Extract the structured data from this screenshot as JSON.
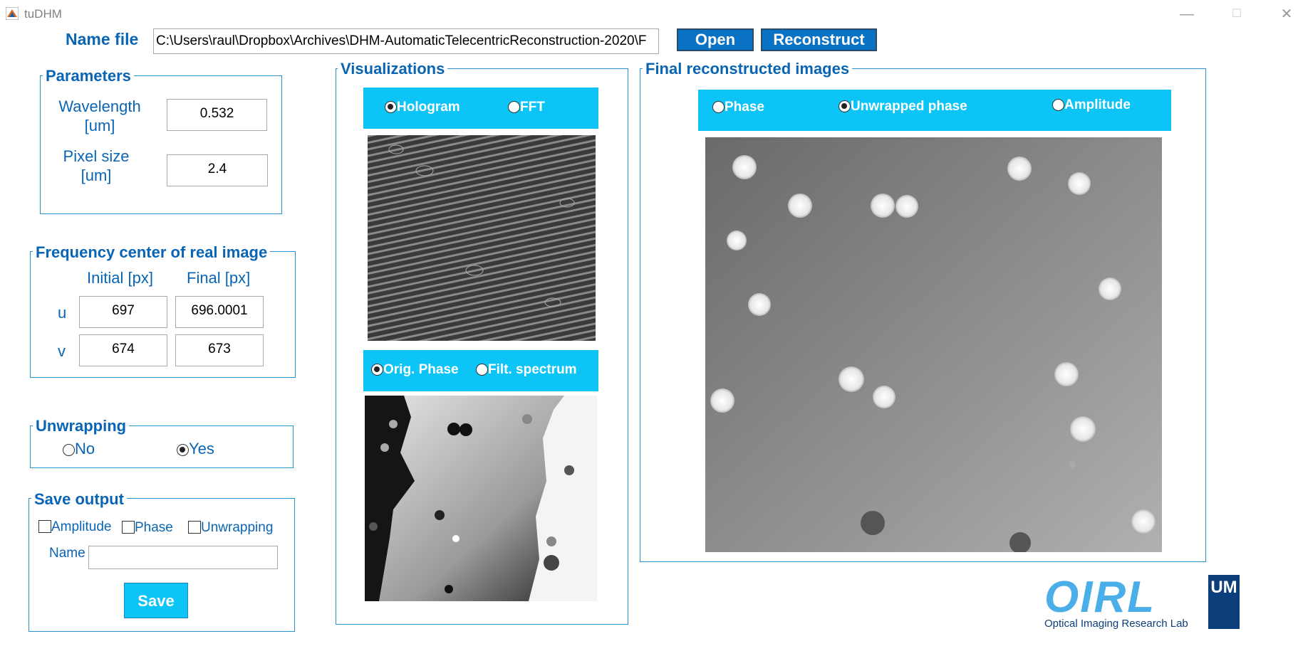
{
  "window": {
    "title": "tuDHM",
    "minimize_icon": "—",
    "maximize_icon": "☐",
    "close_icon": "✕"
  },
  "file": {
    "label": "Name file",
    "path": "C:\\Users\\raul\\Dropbox\\Archives\\DHM-AutomaticTelecentricReconstruction-2020\\F",
    "open_label": "Open",
    "reconstruct_label": "Reconstruct"
  },
  "parameters": {
    "title": "Parameters",
    "wavelength_label_1": "Wavelength",
    "wavelength_label_2": "[um]",
    "wavelength_value": "0.532",
    "pixel_label_1": "Pixel size",
    "pixel_label_2": "[um]",
    "pixel_value": "2.4"
  },
  "frequency": {
    "title": "Frequency center of real image",
    "initial_label": "Initial [px]",
    "final_label": "Final [px]",
    "u_label": "u",
    "v_label": "v",
    "u_initial": "697",
    "u_final": "696.0001",
    "v_initial": "674",
    "v_final": "673"
  },
  "unwrapping": {
    "title": "Unwrapping",
    "no_label": "No",
    "yes_label": "Yes",
    "selected": "Yes"
  },
  "save_output": {
    "title": "Save output",
    "amplitude_label": "Amplitude",
    "phase_label": "Phase",
    "unwrapping_label": "Unwrapping",
    "name_label": "Name",
    "name_value": "",
    "save_label": "Save"
  },
  "visualizations": {
    "title": "Visualizations",
    "top_options": [
      "Hologram",
      "FFT"
    ],
    "top_selected": "Hologram",
    "bottom_options": [
      "Orig. Phase",
      "Filt. spectrum"
    ],
    "bottom_selected": "Orig. Phase"
  },
  "final": {
    "title": "Final reconstructed images",
    "options": [
      "Phase",
      "Unwrapped phase",
      "Amplitude"
    ],
    "selected": "Unwrapped phase"
  },
  "logo": {
    "letters": "OIRL",
    "subtitle": "Optical Imaging Research Lab",
    "badge": "UM"
  },
  "colors": {
    "accent": "#0a64b4",
    "cyan": "#0dc4f7",
    "button": "#0a72c4"
  }
}
